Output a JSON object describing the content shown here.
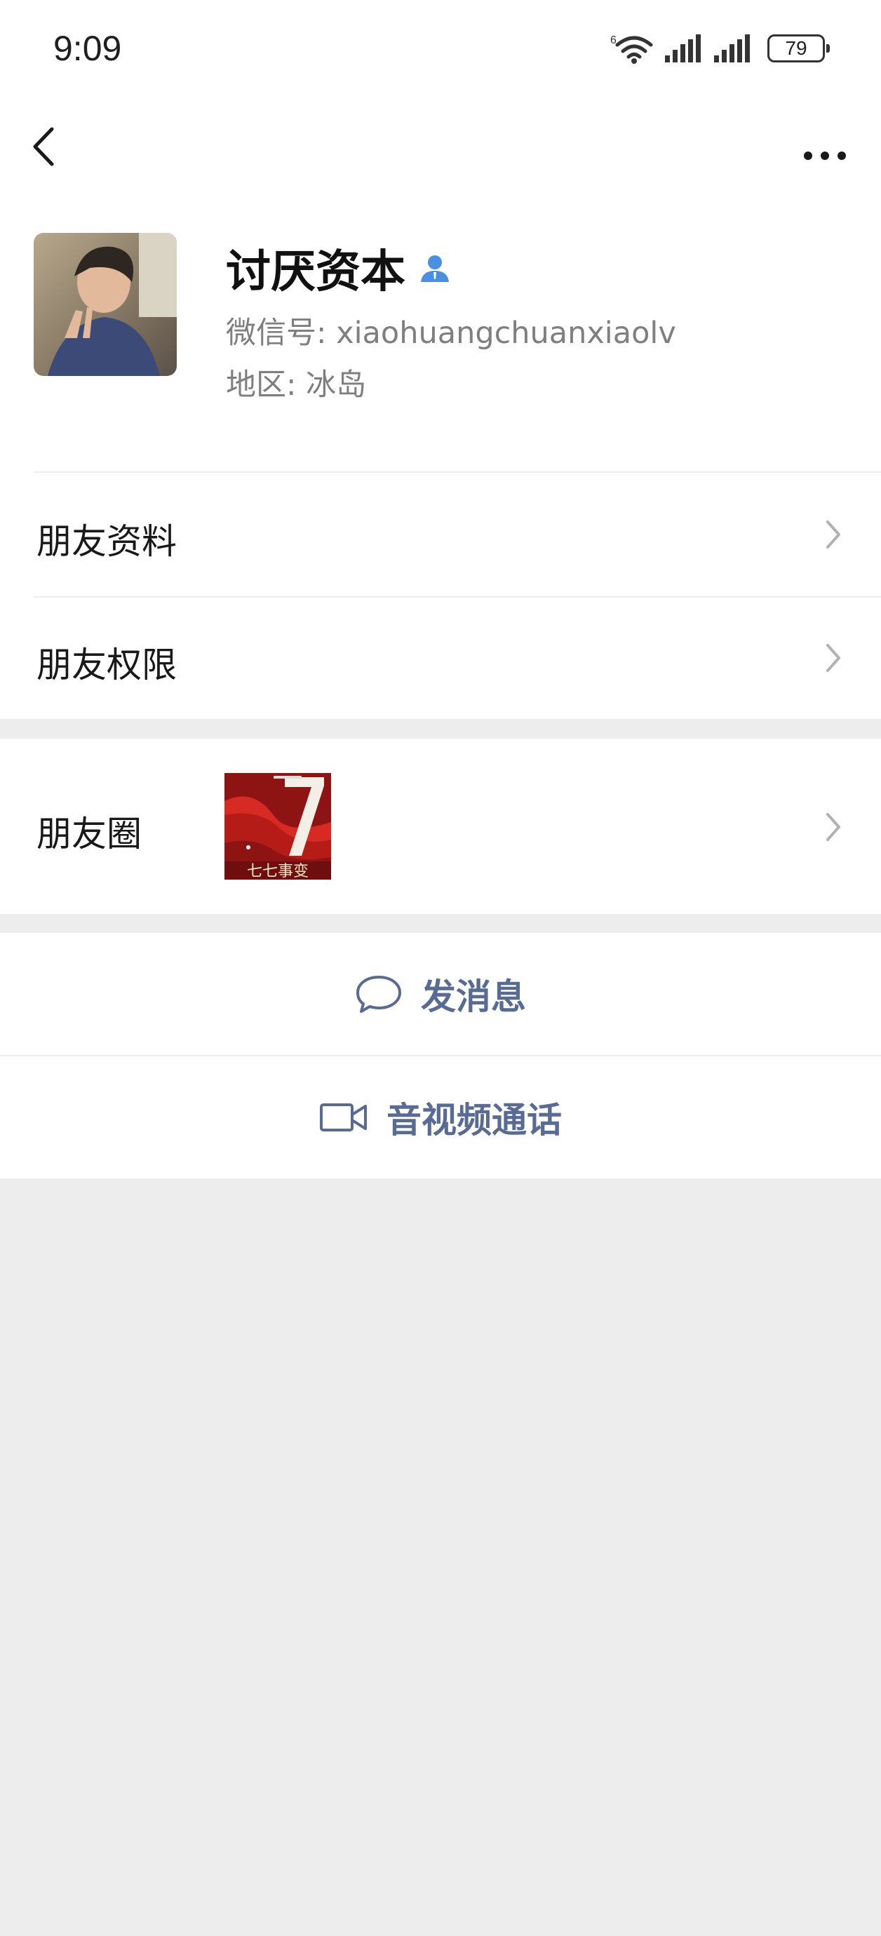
{
  "status_bar": {
    "time": "9:09",
    "battery": "79",
    "wifi_badge": "6"
  },
  "profile": {
    "name": "讨厌资本",
    "wechat_id": "微信号: xiaohuangchuanxiaolv",
    "region": "地区: 冰岛"
  },
  "menu": {
    "friend_info": "朋友资料",
    "friend_permissions": "朋友权限",
    "moments": "朋友圈"
  },
  "moments_thumbnail": {
    "caption": "七七事变"
  },
  "actions": {
    "send_message": "发消息",
    "video_call": "音视频通话"
  },
  "colors": {
    "link_blue": "#576b95",
    "page_gray": "#ededed",
    "verified_blue": "#4a90e2"
  }
}
